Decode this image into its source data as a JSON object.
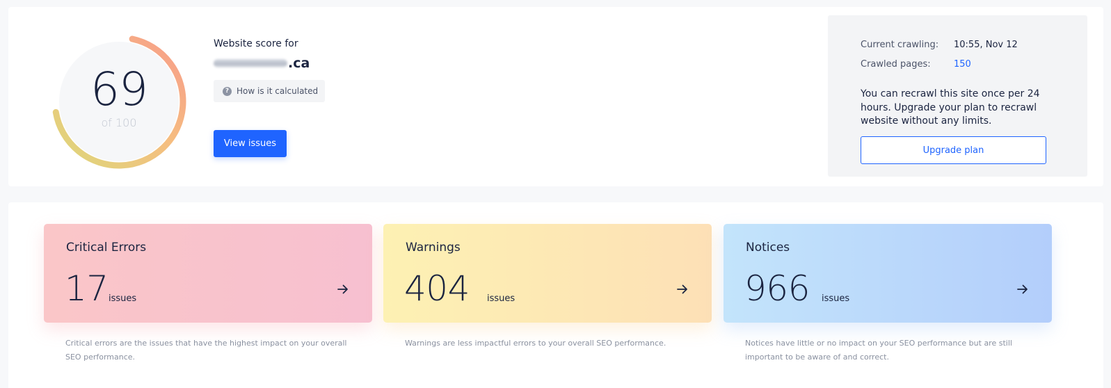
{
  "score": {
    "value": "69",
    "of_label": "of 100",
    "fraction": 0.69,
    "colors": [
      "#dcd87a",
      "#f6bd80",
      "#f79b8a"
    ]
  },
  "site": {
    "label": "Website score for",
    "domain_suffix": ".ca",
    "how_label": "How is it calculated",
    "view_issues_label": "View issues"
  },
  "crawl": {
    "current_label": "Current crawling:",
    "current_value": "10:55, Nov 12",
    "pages_label": "Crawled pages:",
    "pages_value": "150",
    "message": "You can recrawl this site once per 24 hours. Upgrade your plan to recrawl website without any limits.",
    "upgrade_label": "Upgrade plan"
  },
  "issues": [
    {
      "title": "Critical Errors",
      "count": "17",
      "unit": "issues",
      "description": "Critical errors are the issues that have the highest impact on your overall SEO performance."
    },
    {
      "title": "Warnings",
      "count": "404",
      "unit": "issues",
      "description": "Warnings are less impactful errors to your overall SEO performance."
    },
    {
      "title": "Notices",
      "count": "966",
      "unit": "issues",
      "description": "Notices have little or no impact on your SEO performance but are still important to be aware of and correct."
    }
  ],
  "colors": {
    "accent": "#1f64ff",
    "text": "#1b2440"
  },
  "icons": {
    "help": "question-circle-icon",
    "card_arrow": "arrow-right-icon"
  }
}
